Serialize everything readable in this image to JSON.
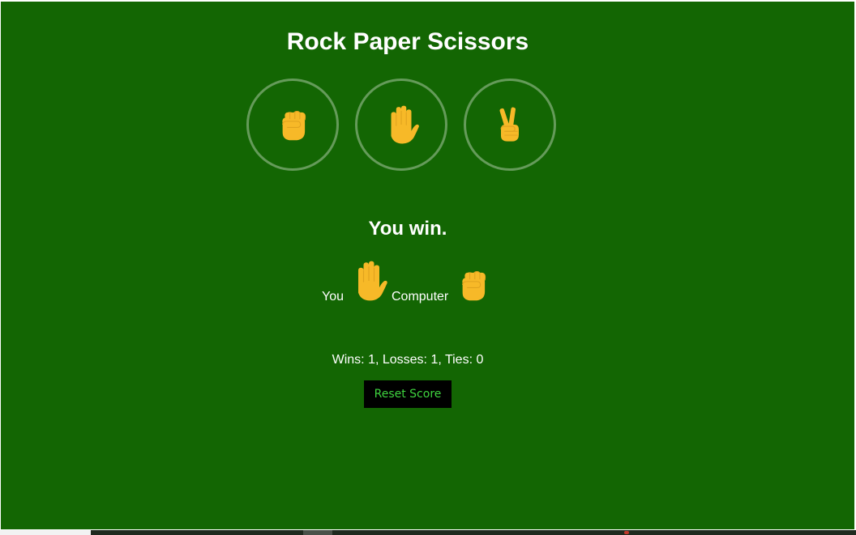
{
  "game": {
    "title": "Rock Paper Scissors",
    "moves": [
      {
        "name": "rock",
        "icon": "rock-fist-icon"
      },
      {
        "name": "paper",
        "icon": "paper-hand-icon"
      },
      {
        "name": "scissors",
        "icon": "scissors-victory-icon"
      }
    ]
  },
  "result": {
    "text": "You win.",
    "you_label": "You",
    "you_move_icon": "paper-hand-icon",
    "computer_label": "Computer",
    "computer_move_icon": "rock-fist-icon"
  },
  "score": {
    "text": "Wins: 1, Losses: 1, Ties: 0",
    "wins": 1,
    "losses": 1,
    "ties": 0
  },
  "reset_button": {
    "label": "Reset Score"
  },
  "colors": {
    "background": "#136603",
    "emoji": "#F7B928",
    "emoji_shade": "#E0A31F",
    "reset_text": "#3FD43F"
  }
}
